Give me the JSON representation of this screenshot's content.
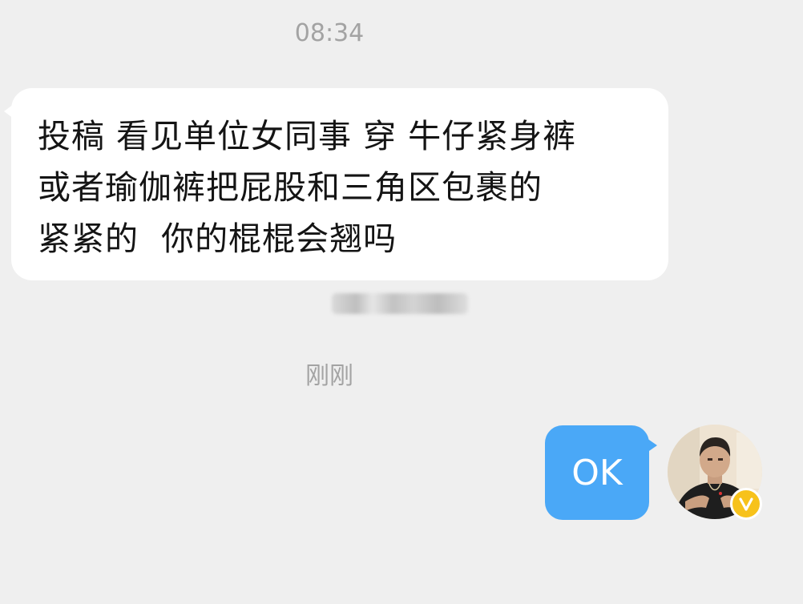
{
  "chat": {
    "time_top": "08:34",
    "incoming_message": {
      "lines": [
        "投稿 看见单位女同事 穿 牛仔紧身裤",
        "或者瑜伽裤把屁股和三角区包裹的",
        "紧紧的  你的棍棍会翘吗"
      ]
    },
    "time_recent": "刚刚",
    "outgoing_message": {
      "text": "OK"
    },
    "badge_letter": "V"
  },
  "colors": {
    "background": "#efefef",
    "incoming_bubble": "#ffffff",
    "outgoing_bubble": "#4aa8f7",
    "timestamp_text": "#a3a3a3",
    "verified_badge": "#f7c21b"
  },
  "icons": {
    "avatar": "user-avatar-photo",
    "badge": "verified-v-badge-icon"
  }
}
